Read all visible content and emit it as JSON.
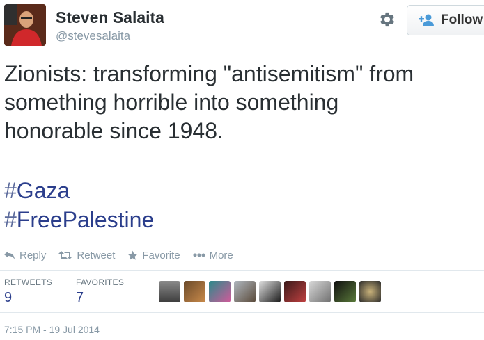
{
  "author": {
    "name": "Steven Salaita",
    "handle": "@stevesalaita"
  },
  "header": {
    "follow_label": "Follow"
  },
  "tweet": {
    "text": "Zionists:  transforming \"antisemitism\" from\nsomething horrible into something\nhonorable since 1948.",
    "hashtags": [
      "Gaza",
      "FreePalestine"
    ]
  },
  "actions": {
    "reply": "Reply",
    "retweet": "Retweet",
    "favorite": "Favorite",
    "more": "More"
  },
  "stats": {
    "retweets_label": "RETWEETS",
    "retweets_value": "9",
    "favorites_label": "FAVORITES",
    "favorites_value": "7"
  },
  "timestamp": "7:15 PM - 19 Jul 2014",
  "colors": {
    "link": "#2b3e8c",
    "muted": "#8899a6",
    "follow_icon": "#4a9ad8"
  },
  "icons": {
    "gear": "gear-icon",
    "follow": "add-user-icon",
    "reply": "reply-icon",
    "retweet": "retweet-icon",
    "favorite": "star-icon",
    "more": "more-dots-icon"
  }
}
